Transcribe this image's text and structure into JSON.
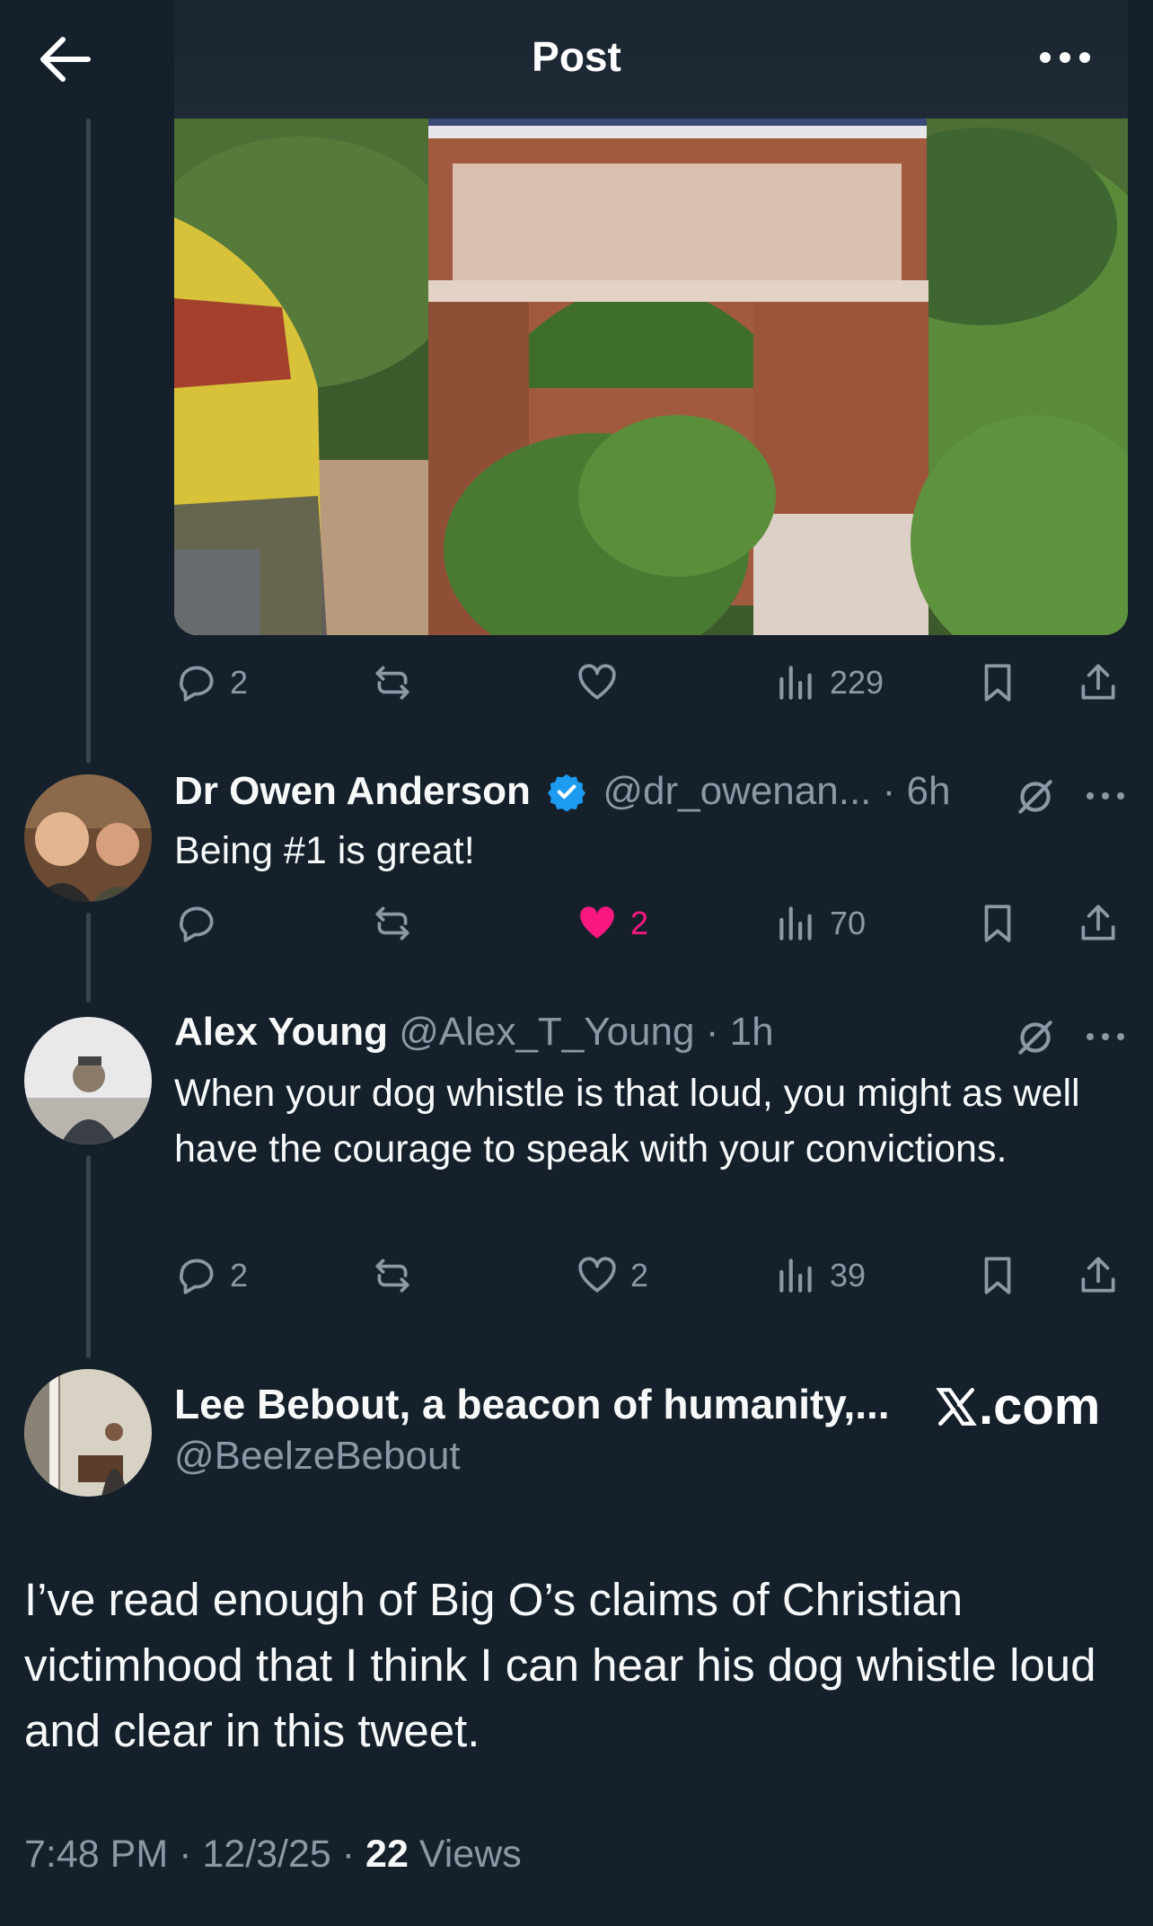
{
  "header": {
    "title": "Post"
  },
  "colors": {
    "background": "#15202b",
    "secondary_text": "#8b98a5",
    "like_pink": "#f91880",
    "verified_blue": "#1d9bf0",
    "thread_line": "#38444d"
  },
  "first_post_actions": {
    "replies": "2",
    "reposts": "",
    "likes": "",
    "views": "229"
  },
  "replies": [
    {
      "name": "Dr Owen Anderson",
      "verified": true,
      "handle": "@dr_owenan...",
      "time": "· 6h",
      "text": "Being #1 is great!",
      "actions": {
        "replies": "",
        "reposts": "",
        "likes": "2",
        "views": "70"
      },
      "liked": true
    },
    {
      "name": "Alex Young",
      "verified": false,
      "handle": "@Alex_T_Young",
      "time": "· 1h",
      "text": "When your dog whistle is that loud, you might as well have the courage to speak with your convictions.",
      "actions": {
        "replies": "2",
        "reposts": "",
        "likes": "2",
        "views": "39"
      },
      "liked": false
    }
  ],
  "main_post": {
    "name": "Lee Bebout, a beacon of humanity,...",
    "handle": "@BeelzeBebout",
    "source": ".com",
    "text": "I’ve read enough of Big O’s claims of Christian victimhood that I think I can hear his dog whistle loud and clear in this tweet.",
    "time": "7:48 PM",
    "date": "12/3/25",
    "views_count": "22",
    "views_label": "Views",
    "separator": " · "
  }
}
